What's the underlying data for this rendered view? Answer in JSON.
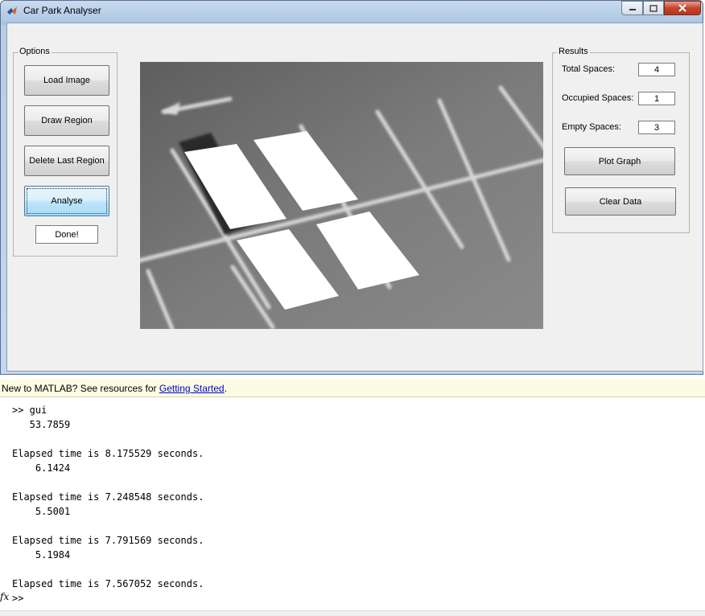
{
  "window": {
    "title": "Car Park Analyser",
    "controls": {
      "minimize": "minimize",
      "maximize": "maximize",
      "close": "close"
    }
  },
  "options": {
    "legend": "Options",
    "load_image": "Load Image",
    "draw_region": "Draw Region",
    "delete_last_region": "Delete Last Region",
    "analyse": "Analyse",
    "done": "Done!"
  },
  "results": {
    "legend": "Results",
    "total_label": "Total Spaces:",
    "total_value": "4",
    "occupied_label": "Occupied Spaces:",
    "occupied_value": "1",
    "empty_label": "Empty Spaces:",
    "empty_value": "3",
    "plot_graph": "Plot Graph",
    "clear_data": "Clear Data"
  },
  "matlab": {
    "info_prefix": "New to MATLAB? See resources for ",
    "info_link": "Getting Started",
    "info_suffix": ".",
    "command_lines": [
      ">> gui",
      "   53.7859",
      "",
      "Elapsed time is 8.175529 seconds.",
      "    6.1424",
      "",
      "Elapsed time is 7.248548 seconds.",
      "    5.5001",
      "",
      "Elapsed time is 7.791569 seconds.",
      "    5.1984",
      "",
      "Elapsed time is 7.567052 seconds."
    ],
    "prompt": ">>",
    "fx_label": "fx"
  },
  "icons": {
    "app": "matlab-logo-icon"
  },
  "colors": {
    "accent": "#3c7fb1",
    "link": "#0000cc",
    "infobar": "#fcfbe3"
  }
}
